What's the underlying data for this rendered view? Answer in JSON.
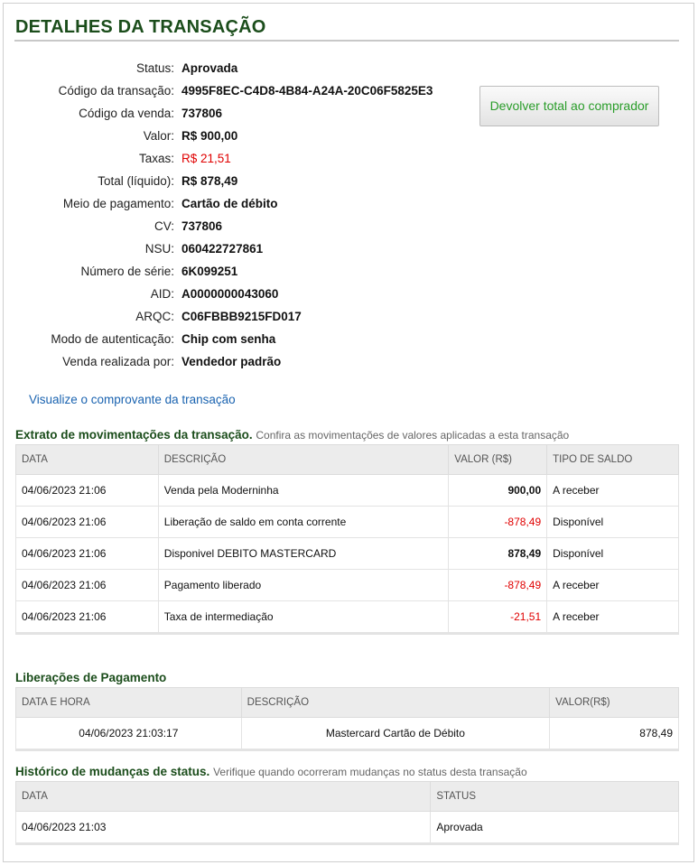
{
  "title": "DETALHES DA TRANSAÇÃO",
  "details": [
    {
      "label": "Status:",
      "value": "Aprovada"
    },
    {
      "label": "Código da transação:",
      "value": "4995F8EC-C4D8-4B84-A24A-20C06F5825E3"
    },
    {
      "label": "Código da venda:",
      "value": "737806"
    },
    {
      "label": "Valor:",
      "value": "R$ 900,00"
    },
    {
      "label": "Taxas:",
      "value": "R$ 21,51"
    },
    {
      "label": "Total (líquido):",
      "value": "R$ 878,49"
    },
    {
      "label": "Meio de pagamento:",
      "value": "Cartão de débito"
    },
    {
      "label": "CV:",
      "value": "737806"
    },
    {
      "label": "NSU:",
      "value": "060422727861"
    },
    {
      "label": "Número de série:",
      "value": "6K099251"
    },
    {
      "label": "AID:",
      "value": "A0000000043060"
    },
    {
      "label": "ARQC:",
      "value": "C06FBBB9215FD017"
    },
    {
      "label": "Modo de autenticação:",
      "value": "Chip com senha"
    },
    {
      "label": "Venda realizada por:",
      "value": "Vendedor padrão"
    }
  ],
  "refund_button": "Devolver total ao comprador",
  "receipt_link": "Visualize o comprovante da transação",
  "statement": {
    "title": "Extrato de movimentações da transação.",
    "subtitle": "Confira as movimentações de valores aplicadas a esta transação",
    "headers": [
      "DATA",
      "DESCRIÇÃO",
      "VALOR (R$)",
      "TIPO DE SALDO"
    ],
    "rows": [
      {
        "date": "04/06/2023 21:06",
        "desc": "Venda pela Moderninha",
        "value": "900,00",
        "type": "A receber"
      },
      {
        "date": "04/06/2023 21:06",
        "desc": "Liberação de saldo em conta corrente",
        "value": "-878,49",
        "type": "Disponível"
      },
      {
        "date": "04/06/2023 21:06",
        "desc": "Disponivel DEBITO MASTERCARD",
        "value": "878,49",
        "type": "Disponível"
      },
      {
        "date": "04/06/2023 21:06",
        "desc": "Pagamento liberado",
        "value": "-878,49",
        "type": "A receber"
      },
      {
        "date": "04/06/2023 21:06",
        "desc": "Taxa de intermediação",
        "value": "-21,51",
        "type": "A receber"
      }
    ]
  },
  "releases": {
    "title": "Liberações de Pagamento",
    "headers": [
      "DATA E HORA",
      "DESCRIÇÃO",
      "VALOR(R$)"
    ],
    "rows": [
      {
        "datetime": "04/06/2023 21:03:17",
        "desc": "Mastercard Cartão de Débito",
        "value": "878,49"
      }
    ]
  },
  "history": {
    "title": "Histórico de mudanças de status.",
    "subtitle": "Verifique quando ocorreram mudanças no status desta transação",
    "headers": [
      "DATA",
      "STATUS"
    ],
    "rows": [
      {
        "date": "04/06/2023 21:03",
        "status": "Aprovada"
      }
    ]
  },
  "colors": {
    "title_green": "#1b4d1b",
    "button_text_green": "#2a9d2a",
    "negative_red": "#e00000",
    "link_blue": "#1a63b0"
  }
}
